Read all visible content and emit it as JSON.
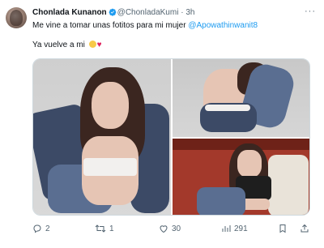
{
  "tweet": {
    "author_name": "Chonlada Kunanon",
    "handle": "@ChonladaKumi",
    "separator": "·",
    "time": "3h",
    "text_prefix": "Me vine a tomar unas fotitos para mi mujer ",
    "mention": "@Apowathinwanit8",
    "text2": "Ya vuelve a mi",
    "emoji_face": "🥹",
    "emoji_heart": "❤️"
  },
  "actions": {
    "replies": "2",
    "retweets": "1",
    "likes": "30",
    "views": "291"
  },
  "colors": {
    "accent": "#1d9bf0",
    "muted": "#536471",
    "verified": "#1d9bf0",
    "heart": "#e0245e"
  },
  "icons": {
    "verified": "verified-badge-icon",
    "more": "more-horizontal-icon",
    "reply": "reply-icon",
    "retweet": "retweet-icon",
    "like": "heart-icon",
    "views": "analytics-icon",
    "bookmark": "bookmark-icon",
    "share": "share-icon"
  }
}
